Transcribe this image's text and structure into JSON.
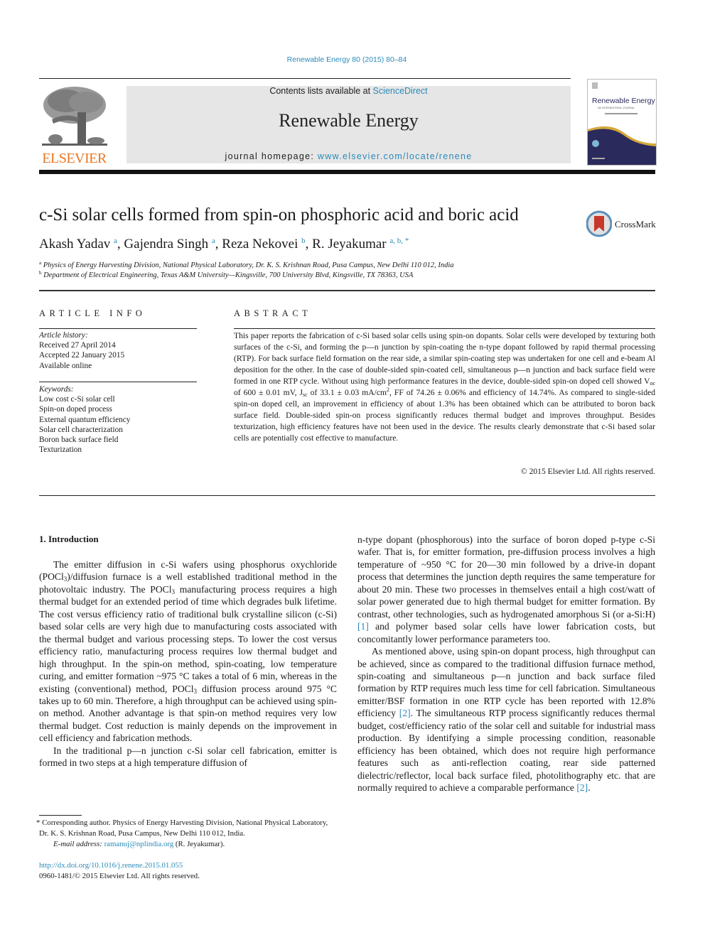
{
  "citation": "Renewable Energy 80 (2015) 80–84",
  "header": {
    "publisher_logo_text": "ELSEVIER",
    "contents_prefix": "Contents lists available at ",
    "contents_link": "ScienceDirect",
    "journal_name": "Renewable Energy",
    "homepage_prefix": "journal homepage: ",
    "homepage_link": "www.elsevier.com/locate/renene",
    "cover_title": "Renewable Energy",
    "cover_subtitle": "AN INTERNATIONAL JOURNAL",
    "colors": {
      "elsevier_orange": "#e87722",
      "link_blue": "#2a8ab8",
      "masthead_gray": "#e6e6e6",
      "cover_navy": "#2b2a5c",
      "cover_gold": "#d4a93c"
    }
  },
  "article": {
    "title": "c-Si solar cells formed from spin-on phosphoric acid and boric acid",
    "crossmark_label": "CrossMark",
    "authors": [
      {
        "name": "Akash Yadav",
        "sup": "a",
        "sep": ", "
      },
      {
        "name": "Gajendra Singh",
        "sup": "a",
        "sep": ", "
      },
      {
        "name": "Reza Nekovei",
        "sup": "b",
        "sep": ", "
      },
      {
        "name": "R. Jeyakumar",
        "sup": "a, b, *",
        "sep": ""
      }
    ],
    "affiliations": [
      {
        "sup": "a",
        "text": "Physics of Energy Harvesting Division, National Physical Laboratory, Dr. K. S. Krishnan Road, Pusa Campus, New Delhi 110 012, India"
      },
      {
        "sup": "b",
        "text": "Department of Electrical Engineering, Texas A&M University—Kingsville, 700 University Blvd, Kingsville, TX 78363, USA"
      }
    ]
  },
  "article_info": {
    "heading": "ARTICLE INFO",
    "history_label": "Article history:",
    "history": [
      "Received 27 April 2014",
      "Accepted 22 January 2015",
      "Available online"
    ],
    "keywords_label": "Keywords:",
    "keywords": [
      "Low cost c-Si solar cell",
      "Spin-on doped process",
      "External quantum efficiency",
      "Solar cell characterization",
      "Boron back surface field",
      "Texturization"
    ]
  },
  "abstract": {
    "heading": "ABSTRACT",
    "part1": "This paper reports the fabrication of c-Si based solar cells using spin-on dopants. Solar cells were developed by texturing both surfaces of the c-Si, and forming the p—n junction by spin-coating the n-type dopant followed by rapid thermal processing (RTP). For back surface field formation on the rear side, a similar spin-coating step was undertaken for one cell and e-beam Al deposition for the other. In the case of double-sided spin-coated cell, simultaneous p—n junction and back surface field were formed in one RTP cycle. Without using high performance features in the device, double-sided spin-on doped cell showed V",
    "voc_sub": "oc",
    "part2": " of 600 ± 0.01 mV, J",
    "jsc_sub": "sc",
    "part3": " of 33.1 ± 0.03 mA/cm",
    "cm_sup": "2",
    "part4": ", FF of 74.26 ± 0.06% and efficiency of 14.74%. As compared to single-sided spin-on doped cell, an improvement in efficiency of about 1.3% has been obtained which can be attributed to boron back surface field. Double-sided spin-on process significantly reduces thermal budget and improves throughput. Besides texturization, high efficiency features have not been used in the device. The results clearly demonstrate that c-Si based solar cells are potentially cost effective to manufacture.",
    "copyright": "© 2015 Elsevier Ltd. All rights reserved."
  },
  "introduction": {
    "heading": "1.  Introduction",
    "left_p1": {
      "a": "The emitter diffusion in c-Si wafers using phosphorus oxychloride (POCl",
      "s1": "3",
      "b": ")/diffusion furnace is a well established traditional method in the photovoltaic industry. The POCl",
      "s2": "3",
      "c": " manufacturing process requires a high thermal budget for an extended period of time which degrades bulk lifetime. The cost versus efficiency ratio of traditional bulk crystalline silicon (c-Si) based solar cells are very high due to manufacturing costs associated with the thermal budget and various processing steps. To lower the cost versus efficiency ratio, manufacturing process requires low thermal budget and high throughput. In the spin-on method, spin-coating, low temperature curing, and emitter formation ~975 °C takes a total of 6 min, whereas in the existing (conventional) method, POCl",
      "s3": "3",
      "d": " diffusion process around 975 °C takes up to 60 min. Therefore, a high throughput can be achieved using spin-on method. Another advantage is that spin-on method requires very low thermal budget. Cost reduction is mainly depends on the improvement in cell efficiency and fabrication methods."
    },
    "left_p2": "In the traditional p—n junction c-Si solar cell fabrication, emitter is formed in two steps at a high temperature diffusion of",
    "right_p1": {
      "a": "n-type dopant (phosphorous) into the surface of boron doped p-type c-Si wafer. That is, for emitter formation, pre-diffusion process involves a high temperature of ~950 °C for 20—30 min followed by a drive-in dopant process that determines the junction depth requires the same temperature for about 20 min. These two processes in themselves entail a high cost/watt of solar power generated due to high thermal budget for emitter formation. By contrast, other technologies, such as hydrogenated amorphous Si (or a-Si:H) ",
      "ref1": "[1]",
      "b": " and polymer based solar cells have lower fabrication costs, but concomitantly lower performance parameters too."
    },
    "right_p2": {
      "a": "As mentioned above, using spin-on dopant process, high throughput can be achieved, since as compared to the traditional diffusion furnace method, spin-coating and simultaneous p—n junction and back surface filed formation by RTP requires much less time for cell fabrication. Simultaneous emitter/BSF formation in one RTP cycle has been reported with 12.8% efficiency ",
      "ref1": "[2]",
      "b": ". The simultaneous RTP process significantly reduces thermal budget, cost/efficiency ratio of the solar cell and suitable for industrial mass production. By identifying a simple processing condition, reasonable efficiency has been obtained, which does not require high performance features such as anti-reflection coating, rear side patterned dielectric/reflector, local back surface filed, photolithography etc. that are normally required to achieve a comparable performance ",
      "ref2": "[2]",
      "c": "."
    }
  },
  "footnotes": {
    "corresponding": "* Corresponding author. Physics of Energy Harvesting Division, National Physical Laboratory, Dr. K. S. Krishnan Road, Pusa Campus, New Delhi 110 012, India.",
    "email_label": "E-mail address: ",
    "email": "ramanuj@nplindia.org",
    "email_suffix": " (R. Jeyakumar).",
    "doi": "http://dx.doi.org/10.1016/j.renene.2015.01.055",
    "issn": "0960-1481/© 2015 Elsevier Ltd. All rights reserved."
  }
}
